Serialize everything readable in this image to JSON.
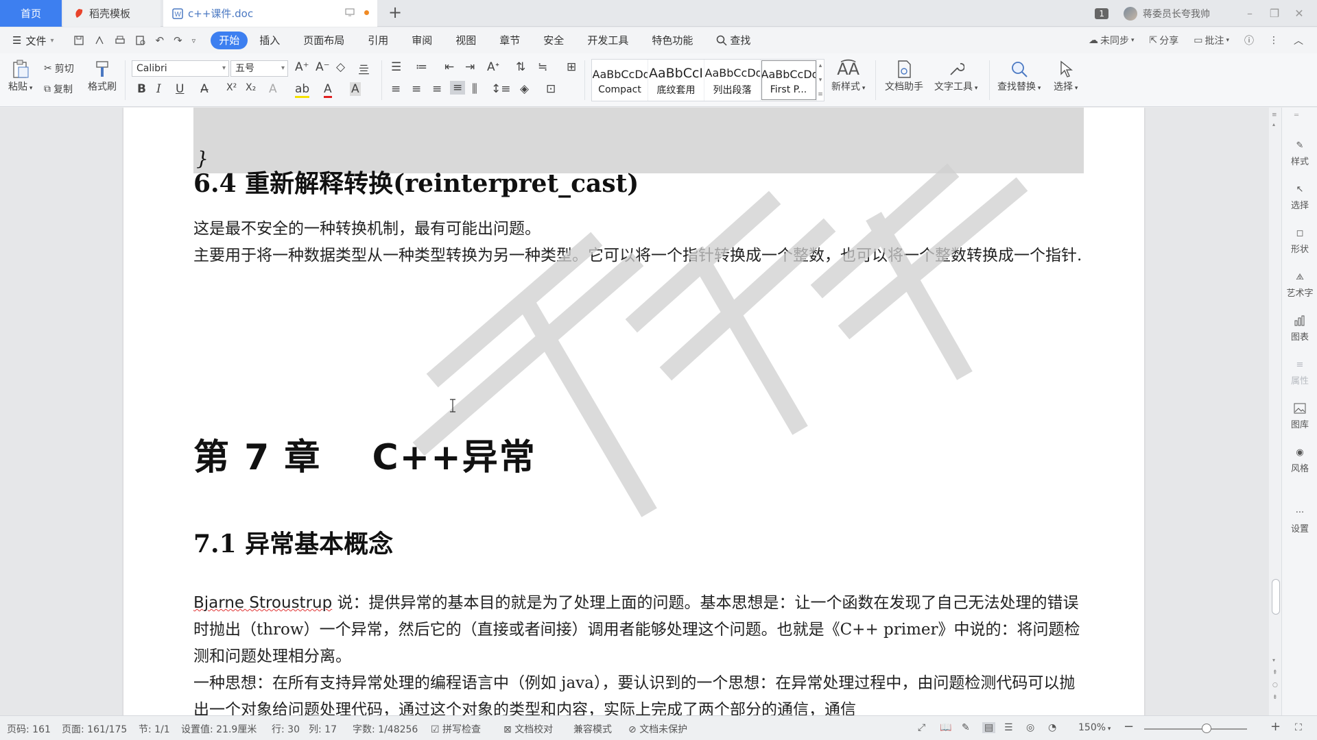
{
  "tabs": {
    "home": "首页",
    "daoke": "稻壳模板",
    "doc": "c++课件.doc"
  },
  "titlebar": {
    "window_count": "1",
    "user_name": "蒋委员长夸我帅"
  },
  "menu": {
    "file": "文件",
    "tabs": [
      "开始",
      "插入",
      "页面布局",
      "引用",
      "审阅",
      "视图",
      "章节",
      "安全",
      "开发工具",
      "特色功能"
    ],
    "search": "查找",
    "sync": "未同步",
    "share": "分享",
    "comment": "批注"
  },
  "ribbon": {
    "paste": "粘贴",
    "cut": "剪切",
    "copy": "复制",
    "format_painter": "格式刷",
    "font_name": "Calibri",
    "font_size": "五号",
    "styles": [
      {
        "preview": "AaBbCcDd",
        "label": "Compact"
      },
      {
        "preview": "AaBbCcI",
        "label": "底纹套用"
      },
      {
        "preview": "AaBbCcDd",
        "label": "列出段落"
      },
      {
        "preview": "AaBbCcDd",
        "label": "First P..."
      }
    ],
    "new_style": "新样式",
    "doc_assistant": "文档助手",
    "text_tools": "文字工具",
    "find_replace": "查找替换",
    "select": "选择"
  },
  "document": {
    "code_close": "}",
    "heading_64": "6.4 重新解释转换(reinterpret_cast)",
    "p1": "这是最不安全的一种转换机制，最有可能出问题。",
    "p2": "主要用于将一种数据类型从一种类型转换为另一种类型。它可以将一个指针转换成一个整数，也可以将一个整数转换成一个指针.",
    "chapter": "第 7 章　 C++异常",
    "heading_71": "7.1  异常基本概念",
    "p3_name": "Bjarne Stroustrup",
    "p3_rest": " 说：提供异常的基本目的就是为了处理上面的问题。基本思想是：让一个函数在发现了自己无法处理的错误时抛出（throw）一个异常，然后它的（直接或者间接）调用者能够处理这个问题。也就是《C++ primer》中说的：将问题检测和问题处理相分离。",
    "p4": "一种思想：在所有支持异常处理的编程语言中（例如 java），要认识到的一个思想：在异常处理过程中，由问题检测代码可以抛出一个对象给问题处理代码，通过这个对象的类型和内容，实际上完成了两个部分的通信，通信"
  },
  "sidepanel": [
    "样式",
    "选择",
    "形状",
    "艺术字",
    "图表",
    "属性",
    "图库",
    "风格",
    "设置"
  ],
  "status": {
    "page_num": "页码: 161",
    "pages": "页面: 161/175",
    "section": "节: 1/1",
    "setting": "设置值: 21.9厘米",
    "row": "行: 30",
    "col": "列: 17",
    "words": "字数: 1/48256",
    "spell": "拼写检查",
    "proof": "文档校对",
    "compat": "兼容模式",
    "protect": "文档未保护",
    "zoom": "150%"
  },
  "colors": {
    "accent": "#3d7ff0",
    "code_bg": "#d9d9d9"
  }
}
